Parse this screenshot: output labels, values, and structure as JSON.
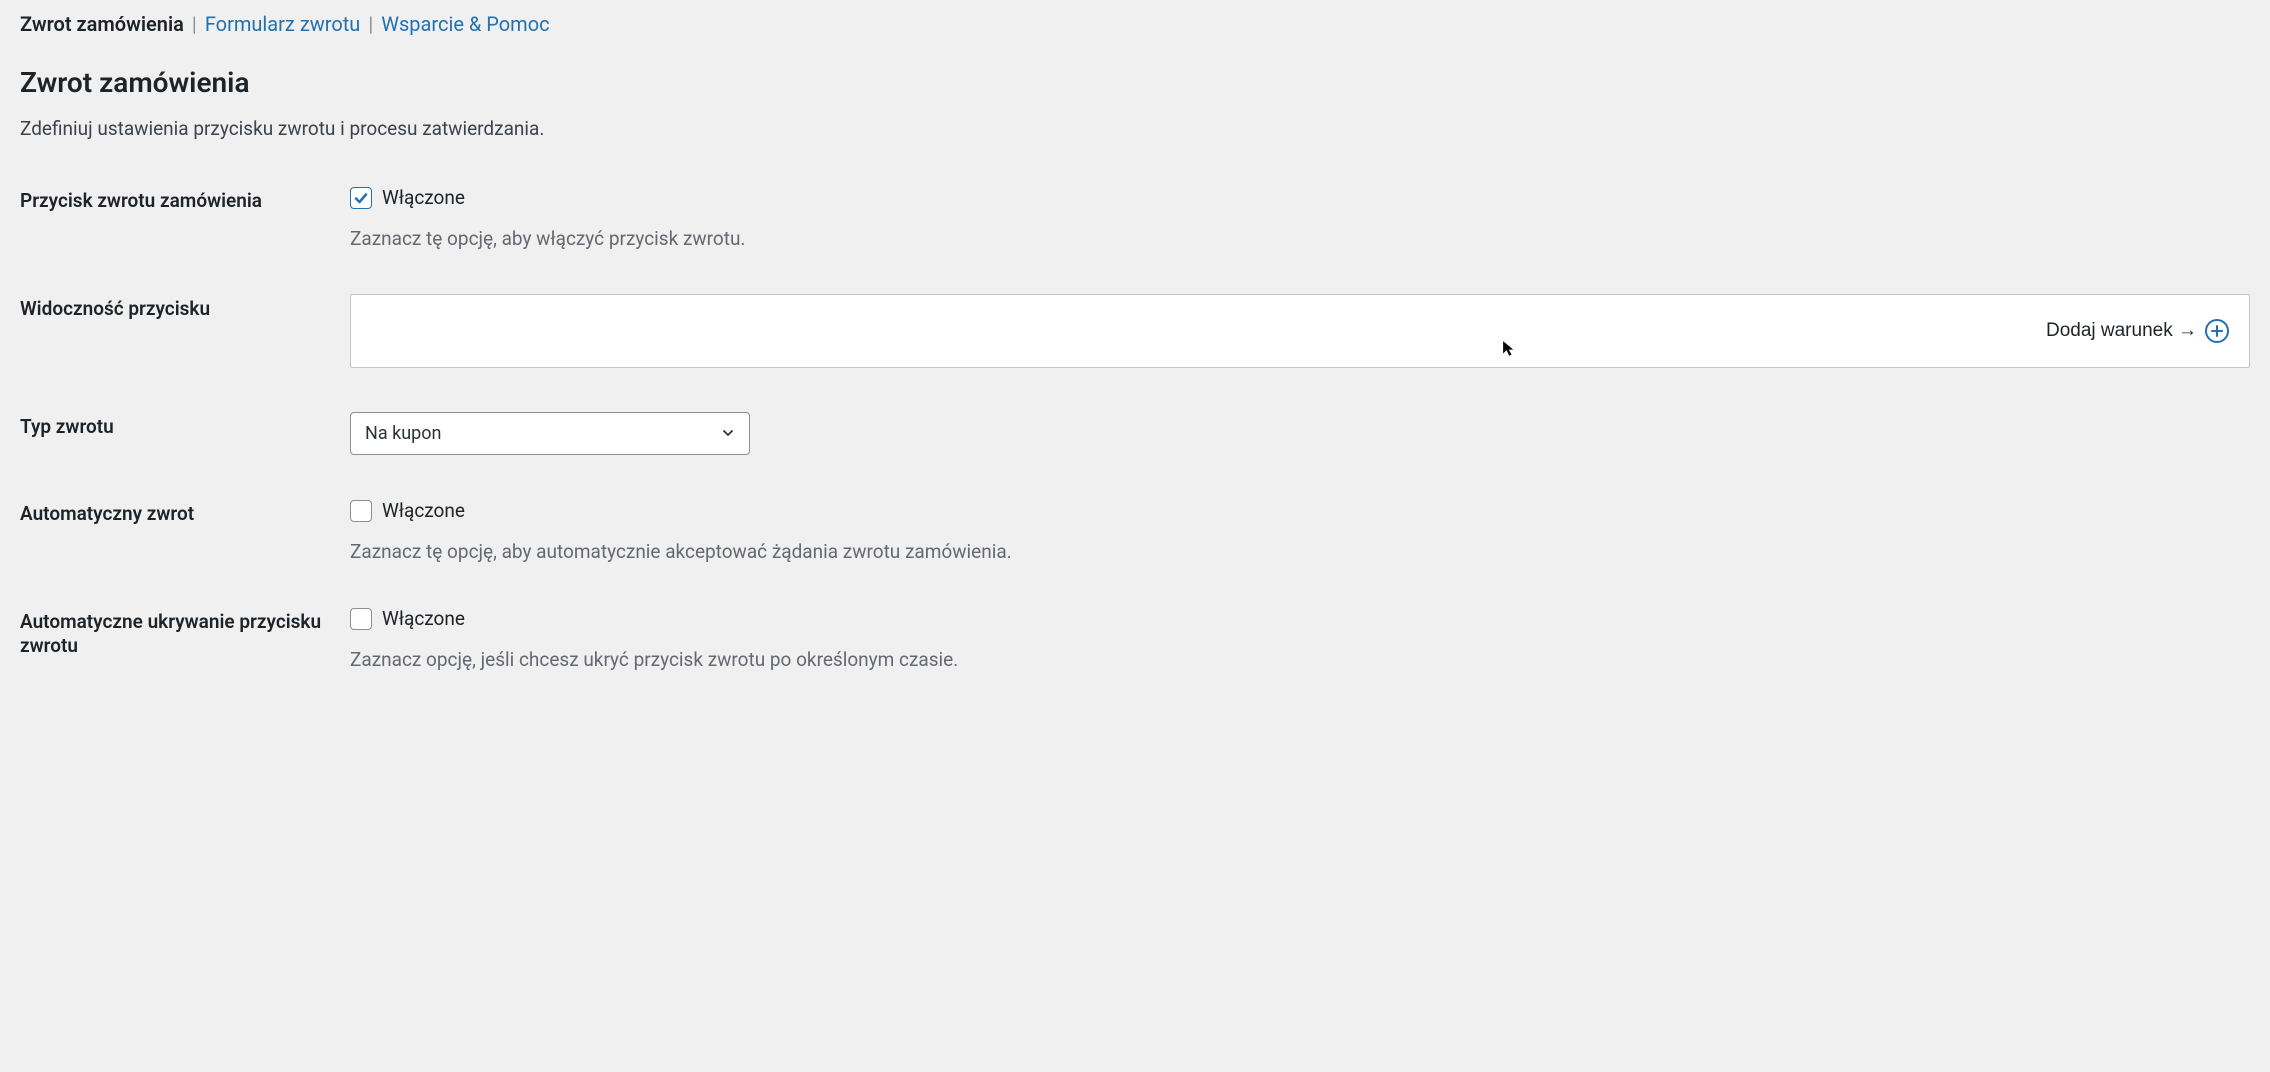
{
  "tabs": {
    "items": [
      {
        "label": "Zwrot zamówienia",
        "active": true
      },
      {
        "label": "Formularz zwrotu",
        "active": false
      },
      {
        "label": "Wsparcie & Pomoc",
        "active": false
      }
    ],
    "separator": "|"
  },
  "page": {
    "title": "Zwrot zamówienia",
    "description": "Zdefiniuj ustawienia przycisku zwrotu i procesu zatwierdzania."
  },
  "fields": {
    "return_button": {
      "label": "Przycisk zwrotu zamówienia",
      "checkbox_label": "Włączone",
      "checked": true,
      "description": "Zaznacz tę opcję, aby włączyć przycisk zwrotu."
    },
    "button_visibility": {
      "label": "Widoczność przycisku",
      "add_condition_label": "Dodaj warunek →"
    },
    "return_type": {
      "label": "Typ zwrotu",
      "selected": "Na kupon"
    },
    "auto_return": {
      "label": "Automatyczny zwrot",
      "checkbox_label": "Włączone",
      "checked": false,
      "description": "Zaznacz tę opcję, aby automatycznie akceptować żądania zwrotu zamówienia."
    },
    "auto_hide": {
      "label": "Automatyczne ukrywanie przycisku zwrotu",
      "checkbox_label": "Włączone",
      "checked": false,
      "description": "Zaznacz opcję, jeśli chcesz ukryć przycisk zwrotu po określonym czasie."
    }
  }
}
